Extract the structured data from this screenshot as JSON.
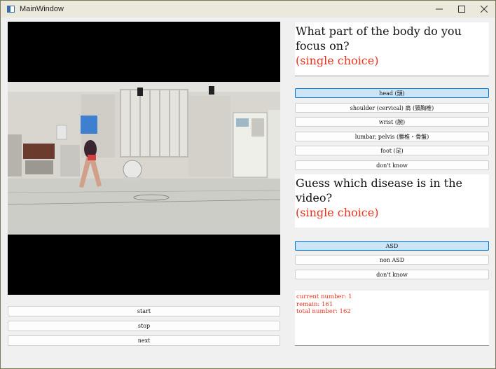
{
  "window": {
    "title": "MainWindow"
  },
  "title_buttons": {
    "minimize": "–",
    "maximize": "□",
    "close": "✕"
  },
  "controls": {
    "start": "start",
    "stop": "stop",
    "next": "next"
  },
  "question1": {
    "text": "What part of the body do you focus on?",
    "hint": "(single choice)",
    "options": [
      {
        "label": "head (頭)",
        "selected": true
      },
      {
        "label": "shoulder (cervical) 肩 (頸胸椎)",
        "selected": false
      },
      {
        "label": "wrist (腕)",
        "selected": false
      },
      {
        "label": "lumbar, pelvis (腰椎・骨盤)",
        "selected": false
      },
      {
        "label": "foot (足)",
        "selected": false
      },
      {
        "label": "don't know",
        "selected": false
      }
    ]
  },
  "question2": {
    "text": "Guess which disease is in the video?",
    "hint": "(single choice)",
    "options": [
      {
        "label": "ASD",
        "selected": true
      },
      {
        "label": "non ASD",
        "selected": false
      },
      {
        "label": "don't know",
        "selected": false
      }
    ]
  },
  "status": {
    "current": "current number: 1",
    "remain": "remain: 161",
    "total": "total number: 162"
  },
  "colors": {
    "accent": "#0078d4",
    "selected_bg": "#cce4f7",
    "hint": "#e8321e"
  }
}
